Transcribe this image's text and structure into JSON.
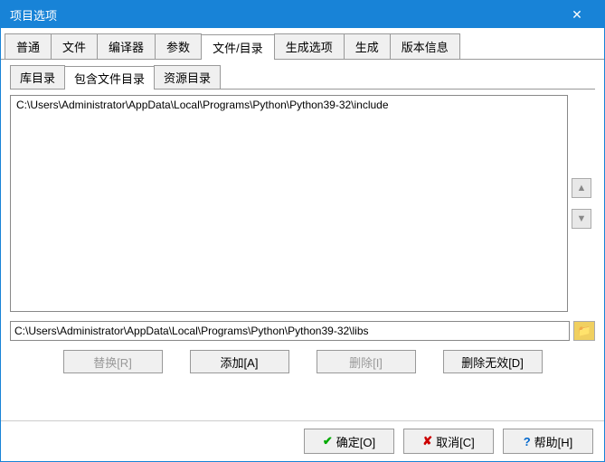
{
  "titlebar": {
    "title": "项目选项"
  },
  "tabs_main": [
    "普通",
    "文件",
    "编译器",
    "参数",
    "文件/目录",
    "生成选项",
    "生成",
    "版本信息"
  ],
  "tabs_main_active": 4,
  "tabs_sub": [
    "库目录",
    "包含文件目录",
    "资源目录"
  ],
  "tabs_sub_active": 1,
  "list_items": [
    "C:\\Users\\Administrator\\AppData\\Local\\Programs\\Python\\Python39-32\\include"
  ],
  "input_value": "C:\\Users\\Administrator\\AppData\\Local\\Programs\\Python\\Python39-32\\libs",
  "buttons": {
    "replace": "替换[R]",
    "add": "添加[A]",
    "delete": "删除[I]",
    "delete_invalid": "删除无效[D]"
  },
  "footer": {
    "ok": "确定[O]",
    "cancel": "取消[C]",
    "help": "帮助[H]"
  },
  "watermark": ""
}
